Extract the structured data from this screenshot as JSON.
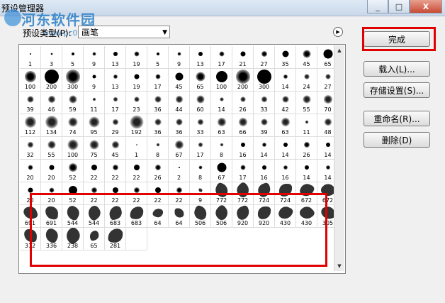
{
  "window": {
    "title": "预设管理器",
    "watermark_text": "河东软件园",
    "watermark_url": "www.pc0359.cn",
    "min": "_",
    "max": "□",
    "close": "X"
  },
  "preset_type": {
    "label": "预设类型(P):",
    "value": "画笔"
  },
  "buttons": {
    "done": "完成",
    "load": "载入(L)...",
    "save": "存储设置(S)...",
    "rename": "重命名(R)...",
    "delete": "删除(D)"
  },
  "brushes": [
    [
      "1",
      "3",
      "5",
      "9",
      "13",
      "19",
      "5",
      "9",
      "13",
      "17",
      "21",
      "27",
      "35",
      "45"
    ],
    [
      "65",
      "100",
      "200",
      "300",
      "9",
      "13",
      "19",
      "17",
      "45",
      "65",
      "100",
      "200",
      "300",
      "14"
    ],
    [
      "24",
      "27",
      "39",
      "46",
      "59",
      "11",
      "17",
      "23",
      "36",
      "44",
      "60",
      "14",
      "26",
      "33"
    ],
    [
      "42",
      "55",
      "70",
      "112",
      "134",
      "74",
      "95",
      "29",
      "192",
      "36",
      "36",
      "33",
      "63",
      "66"
    ],
    [
      "39",
      "63",
      "11",
      "48",
      "32",
      "55",
      "100",
      "75",
      "45",
      "1",
      "8",
      "67",
      "17",
      "8"
    ],
    [
      "16",
      "14",
      "14",
      "26",
      "14",
      "20",
      "20",
      "52",
      "22",
      "22",
      "22",
      "26",
      "2",
      "8"
    ],
    [
      "67",
      "17",
      "16",
      "16",
      "14",
      "14",
      "20",
      "20",
      "52",
      "22",
      "22",
      "22",
      "22",
      "22"
    ],
    [
      "9",
      "772",
      "772",
      "724",
      "724",
      "672",
      "672",
      "691",
      "691",
      "544",
      "544",
      "683",
      "683",
      "64"
    ],
    [
      "64",
      "506",
      "506",
      "920",
      "920",
      "430",
      "430",
      "305",
      "312",
      "336",
      "238",
      "65",
      "281",
      ""
    ]
  ],
  "colors": {
    "highlight": "#e00000",
    "accent": "#2a7fc9"
  }
}
